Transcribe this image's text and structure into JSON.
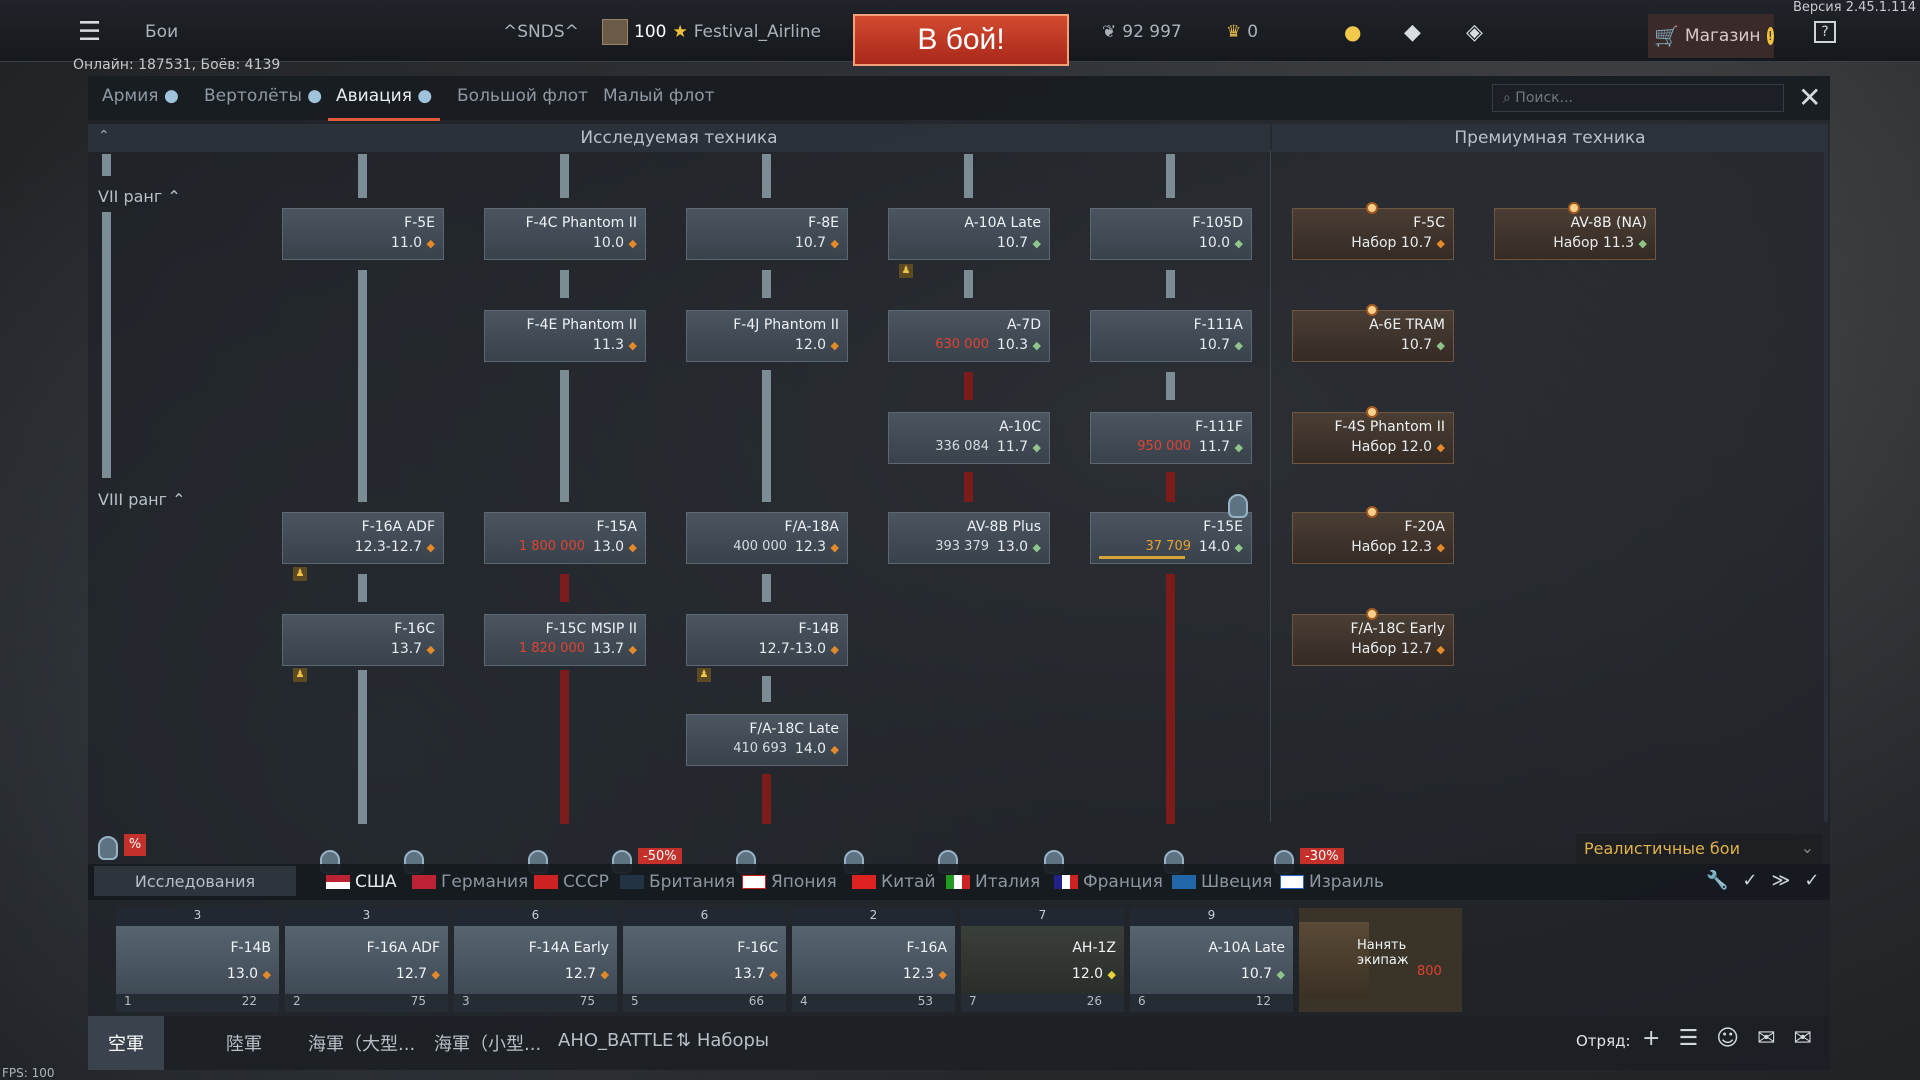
{
  "version": "Версия 2.45.1.114",
  "topbar": {
    "battles": "Бои",
    "squad_tag": "^SNDS^",
    "level": "100",
    "player": "Festival_Airline",
    "to_battle": "В бой!",
    "silver_lions": "92 997",
    "golden_eagles": "0",
    "shop": "Магазин"
  },
  "online": "Онлайн: 187531, Боёв: 4139",
  "tabs": [
    "Армия",
    "Вертолёты",
    "Авиация",
    "Большой флот",
    "Малый флот"
  ],
  "active_tab": "Авиация",
  "search_placeholder": "Поиск...",
  "headers": {
    "researched": "Исследуемая техника",
    "premium": "Премиумная техника"
  },
  "ranks": {
    "r7": "VII ранг",
    "r8": "VIII ранг"
  },
  "cards": {
    "f5e": {
      "name": "F-5E",
      "br": "11.0"
    },
    "f4c": {
      "name": "F-4C Phantom II",
      "br": "10.0"
    },
    "f8e": {
      "name": "F-8E",
      "br": "10.7"
    },
    "a10late": {
      "name": "A-10A Late",
      "br": "10.7"
    },
    "f105d": {
      "name": "F-105D",
      "br": "10.0"
    },
    "f5c": {
      "name": "F-5C",
      "br": "Набор 10.7"
    },
    "av8bna": {
      "name": "AV-8B (NA)",
      "br": "Набор 11.3"
    },
    "f4e": {
      "name": "F-4E Phantom II",
      "br": "11.3"
    },
    "f4j": {
      "name": "F-4J Phantom II",
      "br": "12.0"
    },
    "a7d": {
      "name": "A-7D",
      "cost": "630 000",
      "br": "10.3"
    },
    "f111a": {
      "name": "F-111A",
      "br": "10.7"
    },
    "a6e": {
      "name": "A-6E TRAM",
      "br": "10.7"
    },
    "a10c": {
      "name": "A-10C",
      "cost": "336 084",
      "br": "11.7"
    },
    "f111f": {
      "name": "F-111F",
      "cost": "950 000",
      "br": "11.7"
    },
    "f4s": {
      "name": "F-4S Phantom II",
      "br": "Набор 12.0"
    },
    "f16adf": {
      "name": "F-16A ADF",
      "br": "12.3-12.7"
    },
    "f15a": {
      "name": "F-15A",
      "cost": "1 800 000",
      "br": "13.0"
    },
    "fa18a": {
      "name": "F/A-18A",
      "cost": "400 000",
      "br": "12.3"
    },
    "av8bplus": {
      "name": "AV-8B Plus",
      "cost": "393 379",
      "br": "13.0"
    },
    "f15e": {
      "name": "F-15E",
      "cost": "37 709",
      "br": "14.0"
    },
    "f20a": {
      "name": "F-20A",
      "br": "Набор 12.3"
    },
    "f16c": {
      "name": "F-16C",
      "br": "13.7"
    },
    "f15cmsip": {
      "name": "F-15C MSIP II",
      "cost": "1 820 000",
      "br": "13.7"
    },
    "f14b": {
      "name": "F-14B",
      "br": "12.7-13.0"
    },
    "fa18cearly": {
      "name": "F/A-18C Early",
      "br": "Набор 12.7"
    },
    "fa18clate": {
      "name": "F/A-18C Late",
      "cost": "410 693",
      "br": "14.0"
    }
  },
  "discounts": {
    "britain": "-50%",
    "israel": "-30%"
  },
  "game_mode": "Реалистичные бои",
  "research_button": "Исследования",
  "nations": [
    "США",
    "Германия",
    "СССР",
    "Британия",
    "Япония",
    "Китай",
    "Италия",
    "Франция",
    "Швеция",
    "Израиль"
  ],
  "active_nation": "США",
  "slots": [
    {
      "top": "3",
      "name": "F-14B",
      "br": "13.0",
      "crew": "1",
      "pts": "22"
    },
    {
      "top": "3",
      "name": "F-16A ADF",
      "br": "12.7",
      "crew": "2",
      "pts": "75"
    },
    {
      "top": "6",
      "name": "F-14A Early",
      "br": "12.7",
      "crew": "3",
      "pts": "75"
    },
    {
      "top": "6",
      "name": "F-16C",
      "br": "13.7",
      "crew": "5",
      "pts": "66"
    },
    {
      "top": "2",
      "name": "F-16A",
      "br": "12.3",
      "crew": "4",
      "pts": "53"
    },
    {
      "top": "7",
      "name": "AH-1Z",
      "br": "12.0",
      "crew": "7",
      "pts": "26"
    },
    {
      "top": "9",
      "name": "A-10A Late",
      "br": "10.7",
      "crew": "6",
      "pts": "12"
    }
  ],
  "hire_crew": {
    "label": "Нанять экипаж",
    "cost": "800"
  },
  "bottom_tabs": [
    "空軍",
    "陸軍",
    "海軍（大型...",
    "海軍（小型...",
    "AHO_BATTLE",
    "Наборы"
  ],
  "squad_label": "Отряд:",
  "fps": "FPS: 100",
  "colors": {
    "accent": "#e15a3d",
    "premium": "#6d5743",
    "red_line": "#7b1c1a"
  }
}
